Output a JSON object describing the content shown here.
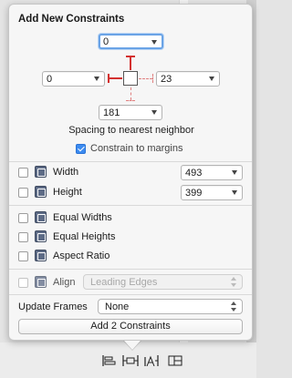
{
  "panel": {
    "title": "Add New Constraints",
    "spacing": {
      "top": "0",
      "left": "0",
      "right": "23",
      "bottom": "181",
      "caption": "Spacing to nearest neighbor"
    },
    "constrain_to_margins": {
      "label": "Constrain to margins",
      "checked": true
    },
    "rows": [
      {
        "label": "Width",
        "checked": false,
        "value": "493",
        "icon": "width-icon"
      },
      {
        "label": "Height",
        "checked": false,
        "value": "399",
        "icon": "height-icon"
      },
      {
        "label": "Equal Widths",
        "checked": false,
        "icon": "equal-widths-icon"
      },
      {
        "label": "Equal Heights",
        "checked": false,
        "icon": "equal-heights-icon"
      },
      {
        "label": "Aspect Ratio",
        "checked": false,
        "icon": "aspect-ratio-icon"
      }
    ],
    "align": {
      "label": "Align",
      "value": "Leading Edges",
      "enabled": false
    },
    "update_frames": {
      "label": "Update Frames",
      "value": "None"
    },
    "add_button": "Add 2 Constraints"
  },
  "toolbar": {
    "icons": [
      "align-icon",
      "pin-icon",
      "resolve-issues-icon",
      "resizing-behavior-icon"
    ]
  },
  "colors": {
    "strut_red": "#d3302f",
    "checkbox_blue": "#3c8bf0",
    "focus_ring": "#6aa3e6"
  }
}
